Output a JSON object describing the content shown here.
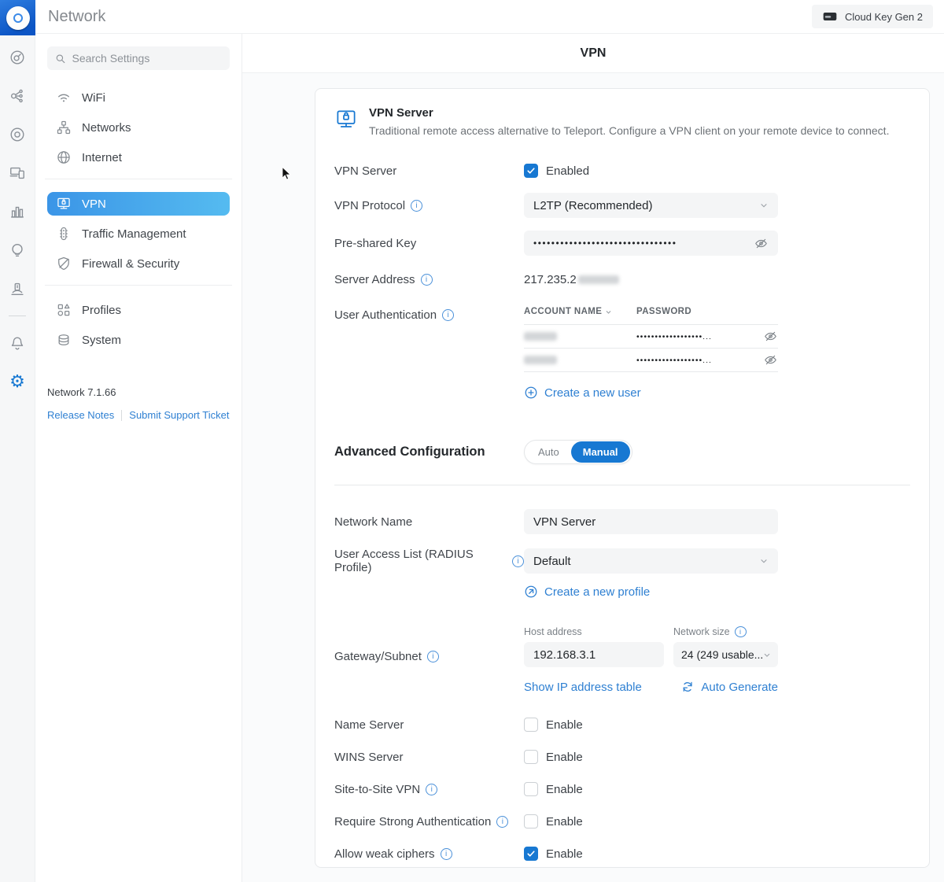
{
  "app": {
    "title": "Network",
    "device_badge": "Cloud Key Gen 2"
  },
  "sidebar": {
    "search_placeholder": "Search Settings",
    "groups": [
      {
        "items": [
          {
            "label": "WiFi"
          },
          {
            "label": "Networks"
          },
          {
            "label": "Internet"
          }
        ]
      },
      {
        "items": [
          {
            "label": "VPN",
            "selected": true
          },
          {
            "label": "Traffic Management"
          },
          {
            "label": "Firewall & Security"
          }
        ]
      },
      {
        "items": [
          {
            "label": "Profiles"
          },
          {
            "label": "System"
          }
        ]
      }
    ],
    "version": "Network 7.1.66",
    "links": [
      {
        "label": "Release Notes"
      },
      {
        "label": "Submit Support Ticket"
      }
    ]
  },
  "page": {
    "title": "VPN"
  },
  "vpn_server": {
    "heading": "VPN Server",
    "description": "Traditional remote access alternative to Teleport. Configure a VPN client on your remote device to connect.",
    "server_label": "VPN Server",
    "enabled_label": "Enabled",
    "enabled_checked": true,
    "protocol_label": "VPN Protocol",
    "protocol_value": "L2TP (Recommended)",
    "psk_label": "Pre-shared Key",
    "psk_masked": "••••••••••••••••••••••••••••••••",
    "address_label": "Server Address",
    "address_visible": "217.235.2",
    "user_auth_label": "User Authentication",
    "table": {
      "col_account": "ACCOUNT NAME",
      "col_password": "PASSWORD",
      "rows": [
        {
          "password_masked": "••••••••••••••••••..."
        },
        {
          "password_masked": "••••••••••••••••••..."
        }
      ],
      "create_label": "Create a new user"
    }
  },
  "advanced": {
    "heading": "Advanced Configuration",
    "toggle_auto": "Auto",
    "toggle_manual": "Manual",
    "toggle_selected": "Manual",
    "network_name_label": "Network Name",
    "network_name_value": "VPN Server",
    "radius_label": "User Access List (RADIUS Profile)",
    "radius_value": "Default",
    "create_profile_label": "Create a new profile",
    "gateway_label": "Gateway/Subnet",
    "host_label": "Host address",
    "host_value": "192.168.3.1",
    "netsize_label": "Network size",
    "netsize_value": "24 (249 usable...",
    "show_ip_label": "Show IP address table",
    "auto_generate_label": "Auto Generate",
    "rows": [
      {
        "label": "Name Server",
        "enable_label": "Enable",
        "checked": false,
        "info": false
      },
      {
        "label": "WINS Server",
        "enable_label": "Enable",
        "checked": false,
        "info": false
      },
      {
        "label": "Site-to-Site VPN",
        "enable_label": "Enable",
        "checked": false,
        "info": true
      },
      {
        "label": "Require Strong Authentication",
        "enable_label": "Enable",
        "checked": false,
        "info": true
      },
      {
        "label": "Allow weak ciphers",
        "enable_label": "Enable",
        "checked": true,
        "info": true
      }
    ]
  },
  "colors": {
    "accent_blue": "#1778d2",
    "link_blue": "#2f80d2",
    "selected_gradient_start": "#3b95e7",
    "selected_gradient_end": "#55bbf0"
  }
}
